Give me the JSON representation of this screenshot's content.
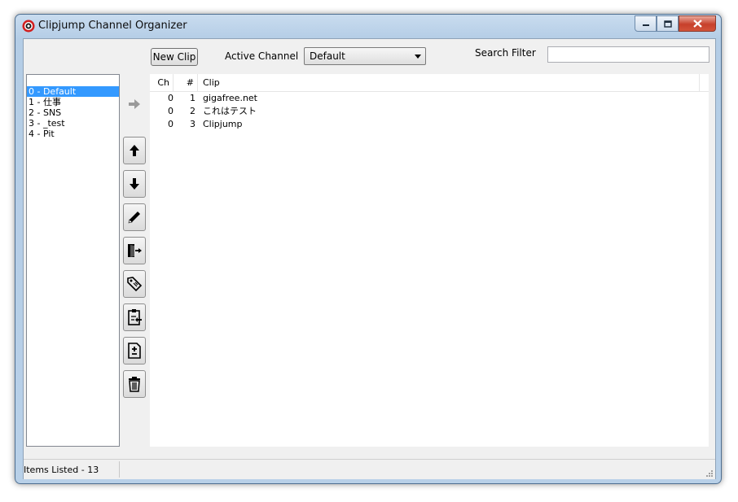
{
  "window": {
    "title": "Clipjump Channel Organizer",
    "accent": "#3399ff",
    "close_color": "#c7402b"
  },
  "toolbar": {
    "new_clip_label": "New Clip",
    "active_channel_label": "Active Channel",
    "active_channel_value": "Default",
    "search_filter_label": "Search Filter",
    "search_value": ""
  },
  "channels": [
    {
      "label": "0 - Default",
      "selected": true
    },
    {
      "label": "1 - 仕事",
      "selected": false
    },
    {
      "label": "2 - SNS",
      "selected": false
    },
    {
      "label": "3 - _test",
      "selected": false
    },
    {
      "label": "4 - Pit",
      "selected": false
    }
  ],
  "tools": [
    {
      "name": "move-right-icon",
      "enabled": false
    },
    {
      "name": "move-up-icon",
      "enabled": true
    },
    {
      "name": "move-down-icon",
      "enabled": true
    },
    {
      "name": "edit-pencil-icon",
      "enabled": true
    },
    {
      "name": "exit-door-icon",
      "enabled": true
    },
    {
      "name": "tags-icon",
      "enabled": true
    },
    {
      "name": "clipboard-paste-icon",
      "enabled": true
    },
    {
      "name": "file-plus-minus-icon",
      "enabled": true
    },
    {
      "name": "trash-icon",
      "enabled": true
    }
  ],
  "clips": {
    "columns": [
      "Ch",
      "#",
      "Clip"
    ],
    "rows": [
      {
        "ch": "0",
        "num": "1",
        "clip": "gigafree.net"
      },
      {
        "ch": "0",
        "num": "2",
        "clip": "これはテスト"
      },
      {
        "ch": "0",
        "num": "3",
        "clip": "Clipjump"
      }
    ]
  },
  "status": {
    "items_listed": "Items Listed - 13"
  }
}
